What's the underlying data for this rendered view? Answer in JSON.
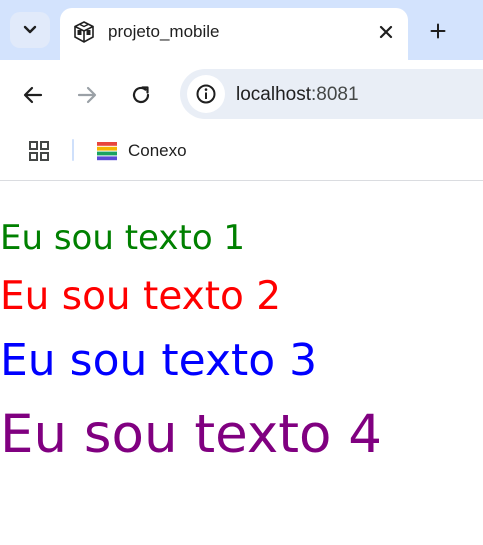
{
  "tab": {
    "title": "projeto_mobile"
  },
  "address_bar": {
    "host": "localhost",
    "port": ":8081"
  },
  "bookmarks": [
    {
      "label": "Conexo"
    }
  ],
  "content": {
    "texts": [
      {
        "text": "Eu sou texto 1",
        "color": "#008000"
      },
      {
        "text": "Eu sou texto 2",
        "color": "#ff0000"
      },
      {
        "text": "Eu sou texto 3",
        "color": "#0000ff"
      },
      {
        "text": "Eu sou texto 4",
        "color": "#800080"
      }
    ]
  },
  "colors": {
    "tabstrip": "#d3e3fd",
    "omnibox": "#e9eef6"
  }
}
